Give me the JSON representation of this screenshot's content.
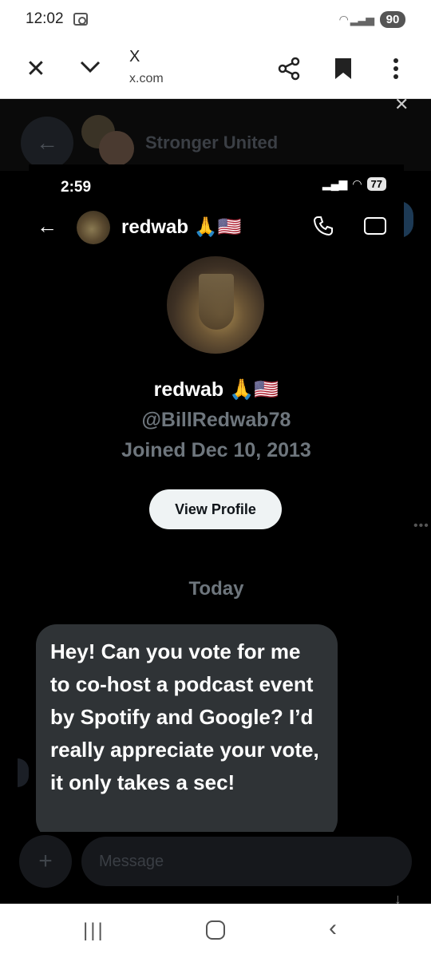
{
  "status_bar": {
    "time": "12:02",
    "battery": "90"
  },
  "browser": {
    "title": "X",
    "url": "x.com"
  },
  "background": {
    "group_title": "Stronger  United",
    "message_placeholder": "Message"
  },
  "inner": {
    "time": "2:59",
    "battery": "77",
    "header_name": "redwab 🙏🇺🇸",
    "profile_name": "redwab 🙏🇺🇸",
    "handle": "@BillRedwab78",
    "joined": "Joined Dec 10, 2013",
    "view_profile_label": "View Profile",
    "date_divider": "Today",
    "message_text": "Hey! Can you vote for me to co-host a podcast event by Spotify and Google? I’d really appreciate your vote, it only takes a sec!"
  },
  "icons": {
    "close": "close-icon",
    "chevron": "chevron-down-icon",
    "share": "share-icon",
    "bookmark": "bookmark-icon",
    "more": "more-vert-icon",
    "back": "back-arrow-icon",
    "call": "phone-icon",
    "video": "video-icon",
    "plus": "plus-icon"
  }
}
